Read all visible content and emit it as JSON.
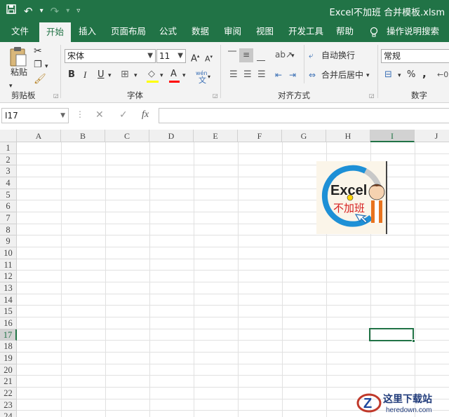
{
  "window": {
    "title": "Excel不加班 合并模板.xlsm"
  },
  "tabs": [
    "文件",
    "开始",
    "插入",
    "页面布局",
    "公式",
    "数据",
    "审阅",
    "视图",
    "开发工具",
    "帮助",
    "操作说明搜索"
  ],
  "ribbon": {
    "clipboard": {
      "paste": "粘贴",
      "label": "剪贴板"
    },
    "font": {
      "name": "宋体",
      "size": "11",
      "label": "字体",
      "grow": "A",
      "shrink": "A",
      "bold": "B",
      "italic": "I",
      "underline": "U",
      "phonetic": "wén"
    },
    "alignment": {
      "wrap": "自动换行",
      "merge": "合并后居中",
      "label": "对齐方式"
    },
    "number": {
      "format": "常规",
      "percent": "%",
      "comma": ",",
      "label": "数字"
    }
  },
  "formula_bar": {
    "name_box": "I17",
    "fx": "fx",
    "cancel": "✕",
    "enter": "✓",
    "value": ""
  },
  "columns": [
    "A",
    "B",
    "C",
    "D",
    "E",
    "F",
    "G",
    "H",
    "I",
    "J"
  ],
  "rows": [
    "1",
    "2",
    "3",
    "4",
    "5",
    "6",
    "7",
    "8",
    "9",
    "10",
    "11",
    "12",
    "13",
    "14",
    "15",
    "16",
    "17",
    "18",
    "19",
    "20",
    "21",
    "22",
    "23",
    "24"
  ],
  "selected": {
    "cell": "I17",
    "column": "I",
    "row": "17"
  },
  "logo": {
    "text_en": "Excel",
    "text_cn": "不加班"
  },
  "watermark": {
    "title": "这里下载站",
    "url": "heredown.com"
  },
  "colors": {
    "brand": "#217346",
    "ribbon_bg": "#f3f3f3",
    "grid_line": "#e1e1e1",
    "highlight": "#ffff00",
    "font_color": "#ff0000"
  },
  "icons": [
    "save-icon",
    "undo-icon",
    "redo-icon",
    "customize-qat-icon",
    "lightbulb-icon",
    "cut-icon",
    "copy-icon",
    "format-painter-icon"
  ]
}
